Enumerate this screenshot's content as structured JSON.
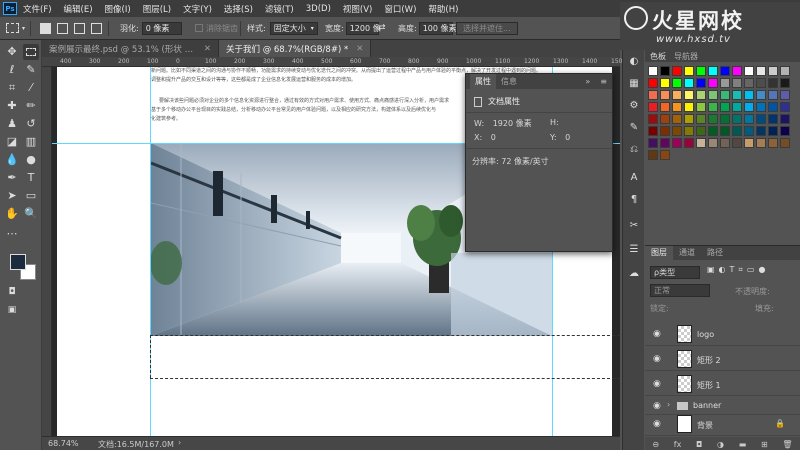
{
  "app": {
    "logo": "Ps"
  },
  "menu": [
    "文件(F)",
    "编辑(E)",
    "图像(I)",
    "图层(L)",
    "文字(Y)",
    "选择(S)",
    "滤镜(T)",
    "3D(D)",
    "视图(V)",
    "窗口(W)",
    "帮助(H)"
  ],
  "options": {
    "feather_label": "羽化:",
    "feather_value": "0 像素",
    "antialias_label": "消除锯齿",
    "style_label": "样式:",
    "style_value": "固定大小",
    "width_label": "宽度:",
    "width_value": "1200 像",
    "height_label": "高度:",
    "height_value": "100 像素",
    "select_mask": "选择并遮住..."
  },
  "tabs": [
    {
      "label": "案例展示最终.psd @ 53.1% (形状 6, RGB/8) *",
      "active": false
    },
    {
      "label": "关于我们 @ 68.7%(RGB/8#) *",
      "active": true
    }
  ],
  "ruler_ticks": [
    "400",
    "300",
    "200",
    "100",
    "0",
    "100",
    "200",
    "300",
    "400",
    "500",
    "600",
    "700",
    "800",
    "900",
    "1000",
    "1100",
    "1200",
    "1300",
    "1400",
    "1500"
  ],
  "doc_text": {
    "line1": "新问题。比如不同渠道之间的沟通与协作不顺畅，功能需求的持续变动与优化迭代之间的冲突。从而提出了运营过程中产品与用户体验的平衡点，解决了开发过程中遇到的问题。",
    "line2": "调整和提升产品的交互和设计等等，这些都是成了企业信息化发展运营和服务的成本的增加。",
    "line3": "要解决该些问题必须对企业的多个信息化资源进行整合，通过有效的方式对用户需求、使用方式、痛点痛感进行深入分析，用户需求",
    "line4": "基于多个移动办公平台现目的实践总结，分析移动办公平台常见的用户体验问题，以及相应的研究方法，构建体系以及后续优化与",
    "line5": "化建筑参考。"
  },
  "properties_panel": {
    "tabs": [
      "属性",
      "信息"
    ],
    "title": "文档属性",
    "w_label": "W:",
    "w_value": "1920 像素",
    "h_label": "H:",
    "x_label": "X:",
    "x_value": "0",
    "y_label": "Y:",
    "y_value": "0",
    "resolution": "分辨率: 72 像素/英寸"
  },
  "status": {
    "zoom": "68.74%",
    "doc": "文档:16.5M/167.0M"
  },
  "swatches_panel": {
    "tabs": [
      "色板",
      "导航器"
    ],
    "colors": [
      "#ffffff",
      "#000000",
      "#ff0000",
      "#ffff00",
      "#00ff00",
      "#00ffff",
      "#0000ff",
      "#ff00ff",
      "#ffffff",
      "#e6e6e6",
      "#cccccc",
      "#b3b3b3",
      "#ff0000",
      "#ffff00",
      "#00ff00",
      "#00ffff",
      "#0000ff",
      "#ff00ff",
      "#999999",
      "#808080",
      "#666666",
      "#4d4d4d",
      "#333333",
      "#1a1a1a",
      "#f26c4f",
      "#f68e55",
      "#fbaf5c",
      "#fff467",
      "#acd372",
      "#7cc576",
      "#3bb878",
      "#1abbb4",
      "#00bff3",
      "#438cca",
      "#5574b9",
      "#605ca8",
      "#ed1c24",
      "#f26522",
      "#f7941d",
      "#fff200",
      "#8dc63f",
      "#39b54a",
      "#00a651",
      "#00a99d",
      "#00aeef",
      "#0072bc",
      "#0054a6",
      "#2e3192",
      "#9e0b0f",
      "#a0410d",
      "#a36209",
      "#aba000",
      "#598527",
      "#1a7b30",
      "#007236",
      "#00746b",
      "#0076a3",
      "#004b80",
      "#003471",
      "#1b1464",
      "#790000",
      "#7b2e00",
      "#7d4900",
      "#827b00",
      "#406618",
      "#005e20",
      "#005826",
      "#005952",
      "#005b7f",
      "#003663",
      "#002157",
      "#0d004c",
      "#440e62",
      "#630460",
      "#9e005d",
      "#9e0039",
      "#c7b299",
      "#998675",
      "#736357",
      "#534741",
      "#c69c6d",
      "#a67c52",
      "#8c6239",
      "#754c24",
      "#603913",
      "#8b4513"
    ]
  },
  "layers_panel": {
    "tabs": [
      "图层",
      "通道",
      "路径"
    ],
    "filter_label": "ρ类型",
    "blend_mode": "正常",
    "opacity_label": "不透明度:",
    "lock_label": "锁定:",
    "fill_label": "填充:",
    "layers": [
      {
        "name": "logo"
      },
      {
        "name": "矩形 2"
      },
      {
        "name": "矩形 1"
      },
      {
        "name": "banner",
        "group": true
      },
      {
        "name": "背景",
        "locked": true
      }
    ]
  },
  "watermark": {
    "brand": "火星网校",
    "url": "www.hxsd.tv"
  }
}
